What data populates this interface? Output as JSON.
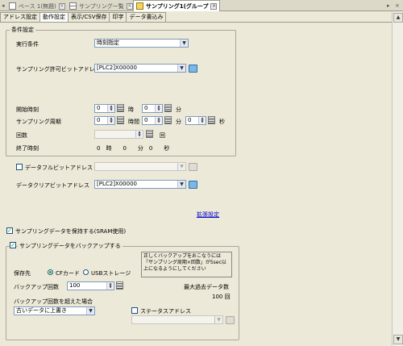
{
  "window_tabs": [
    {
      "label": "ベース 1(無題)",
      "active": false
    },
    {
      "label": "サンプリング一覧",
      "active": false
    },
    {
      "label": "サンプリング1(グループ",
      "active": true
    }
  ],
  "sub_tabs": [
    "アドレス設定",
    "動作設定",
    "表示/CSV保存",
    "印字",
    "データ書込み"
  ],
  "condition": {
    "legend": "条件設定",
    "exec_label": "実行条件",
    "exec_value": "時刻指定",
    "permit_label": "サンプリング許可ビットアドレス",
    "permit_value": "[PLC2]X00000",
    "start_label": "開始時刻",
    "start_hour": "0",
    "start_min": "0",
    "hour_unit": "時",
    "min_unit": "分",
    "sec_unit": "秒",
    "period_label": "サンプリング周期",
    "period_hour": "0",
    "period_min": "0",
    "period_sec": "0",
    "period_hour_unit": "時間",
    "count_label": "回数",
    "count_unit": "回",
    "end_label": "終了時刻",
    "end_value": "0　時　　0　　分　0　　秒"
  },
  "dataful": {
    "label": "データフルビットアドレス",
    "checked": false
  },
  "clear": {
    "label": "データクリアビットアドレス",
    "value": "[PLC2]X00000"
  },
  "extended_link": "拡張設定",
  "keep_data": {
    "label": "サンプリングデータを保持する(SRAM使用)",
    "checked": true
  },
  "backup": {
    "label": "サンプリングデータをバックアップする",
    "checked": true,
    "dest_label": "保存先",
    "cf_label": "CFカード",
    "usb_label": "USBストレージ",
    "dest_selected": "CFカード",
    "count_label": "バックアップ回数",
    "count_value": "100",
    "note": "正しくバックアップをおこなうには「サンプリング周期×回数」が5sec以上になるようにしてください",
    "max_label": "最大過去データ数",
    "max_value": "100 回",
    "exceed_label": "バックアップ回数を超えた場合",
    "exceed_value": "古いデータに上書き",
    "status_label": "ステータスアドレス",
    "status_checked": false
  }
}
